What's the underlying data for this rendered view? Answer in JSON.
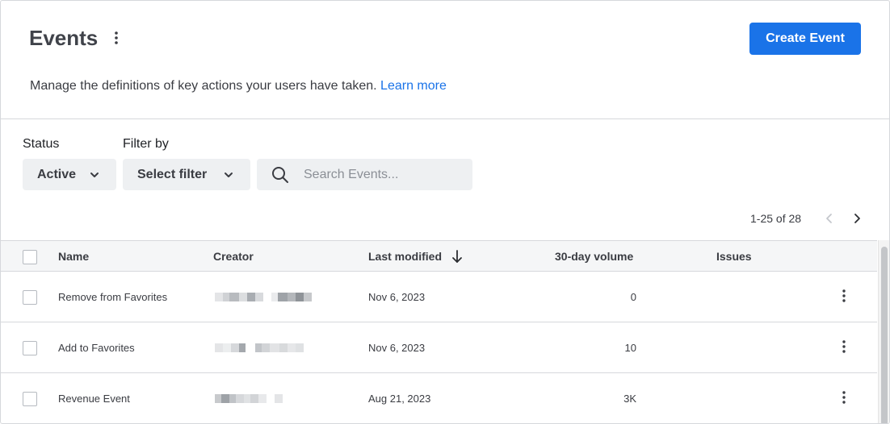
{
  "header": {
    "title": "Events",
    "create_button": "Create Event",
    "description": "Manage the definitions of key actions your users have taken.",
    "learn_more": "Learn more",
    "accent": "#1a73e8"
  },
  "filters": {
    "status_label": "Status",
    "status_value": "Active",
    "filter_label": "Filter by",
    "filter_value": "Select filter",
    "search_placeholder": "Search Events..."
  },
  "pagination": {
    "range_text": "1-25 of 28"
  },
  "table": {
    "columns": [
      "Name",
      "Creator",
      "Last modified",
      "30-day volume",
      "Issues"
    ],
    "rows": [
      {
        "name": "Remove from Favorites",
        "last_modified": "Nov 6, 2023",
        "volume": "0",
        "issues": ""
      },
      {
        "name": "Add to Favorites",
        "last_modified": "Nov 6, 2023",
        "volume": "10",
        "issues": ""
      },
      {
        "name": "Revenue Event",
        "last_modified": "Aug 21, 2023",
        "volume": "3K",
        "issues": ""
      }
    ]
  }
}
